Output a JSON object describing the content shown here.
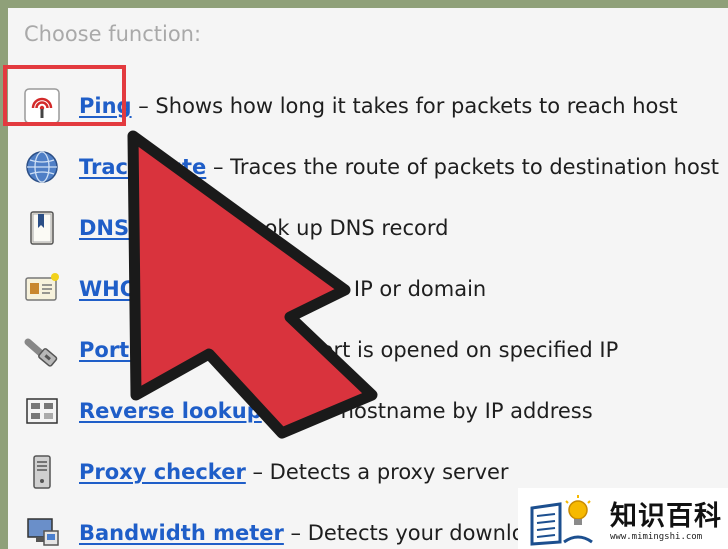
{
  "heading": "Choose function:",
  "functions": [
    {
      "link": "Ping",
      "desc": " – Shows how long it takes for packets to reach host",
      "icon": "ping-icon"
    },
    {
      "link": "Traceroute",
      "desc": " – Traces the route of packets to destination host",
      "icon": "globe-icon"
    },
    {
      "link": "DNS lookup",
      "desc": " – Look up DNS record",
      "icon": "dns-book-icon"
    },
    {
      "link": "WHOIS",
      "desc": " – Gets info for an IP or domain",
      "icon": "id-card-icon"
    },
    {
      "link": "Port check",
      "desc": " – Tests if port is opened on specified IP",
      "icon": "network-plug-icon"
    },
    {
      "link": "Reverse lookup",
      "desc": " – Gets hostname by IP address",
      "icon": "server-window-icon"
    },
    {
      "link": "Proxy checker",
      "desc": " – Detects a proxy server",
      "icon": "proxy-server-icon"
    },
    {
      "link": "Bandwidth meter",
      "desc": " – Detects your download speed",
      "icon": "monitor-icon"
    }
  ],
  "watermark": {
    "text": "知识百科",
    "url": "www.mimingshi.com"
  },
  "colors": {
    "link": "#1f5ec8",
    "highlight": "#e33a3f",
    "arrow_fill": "#d9333d",
    "arrow_stroke": "#1a1a1a"
  }
}
